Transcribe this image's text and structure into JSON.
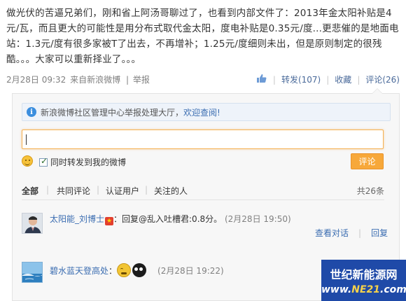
{
  "post": {
    "text": "做光伏的苦逼兄弟们，刚和省上阿汤哥聊过了，也看到内部文件了：2013年金太阳补贴是4元/瓦，而且更大的可能性是用分布式取代金太阳，度电补贴是0.35元/度...更悲催的是地面电站：1.3元/度有很多家被T了出去，不再增补；1.25元/度细则未出，但是原则制定的很残酷。。。大家可以重新择业了。。。"
  },
  "meta": {
    "time": "2月28日 09:32",
    "source": "来自新浪微博",
    "report": "举报",
    "repost": "转发(107)",
    "favorite": "收藏",
    "comment": "评论(26)"
  },
  "comment_box": {
    "notice_prefix": "新浪微博社区管理中心举报处理大厅，",
    "notice_link": "欢迎查阅!",
    "input_value": "",
    "also_repost": "同时转发到我的微博",
    "submit": "评论"
  },
  "filters": {
    "all": "全部",
    "mutual": "共同评论",
    "verified": "认证用户",
    "following": "关注的人",
    "total": "共26条"
  },
  "comments": [
    {
      "name": "太阳能_刘博士",
      "text": "：回复@乱入吐槽君:0.8分。",
      "time": "(2月28日 19:50)",
      "view_thread": "查看对话",
      "reply": "回复"
    },
    {
      "name": "碧水蓝天登高处",
      "text": "：",
      "time": "(2月28日 19:22)"
    }
  ],
  "watermark": {
    "title": "世纪新能源网",
    "url_prefix": "www.",
    "url_accent": "NE21",
    "url_suffix": ".com"
  },
  "colors": {
    "link": "#3b6db1",
    "accent": "#f7a83a",
    "watermark_bg": "#1f4aa8"
  },
  "icons": [
    "like-thumb-icon",
    "info-icon",
    "smiley-icon",
    "checkbox-checked",
    "verified-star-icon",
    "crying-emoticon",
    "black-face-emoticon"
  ]
}
